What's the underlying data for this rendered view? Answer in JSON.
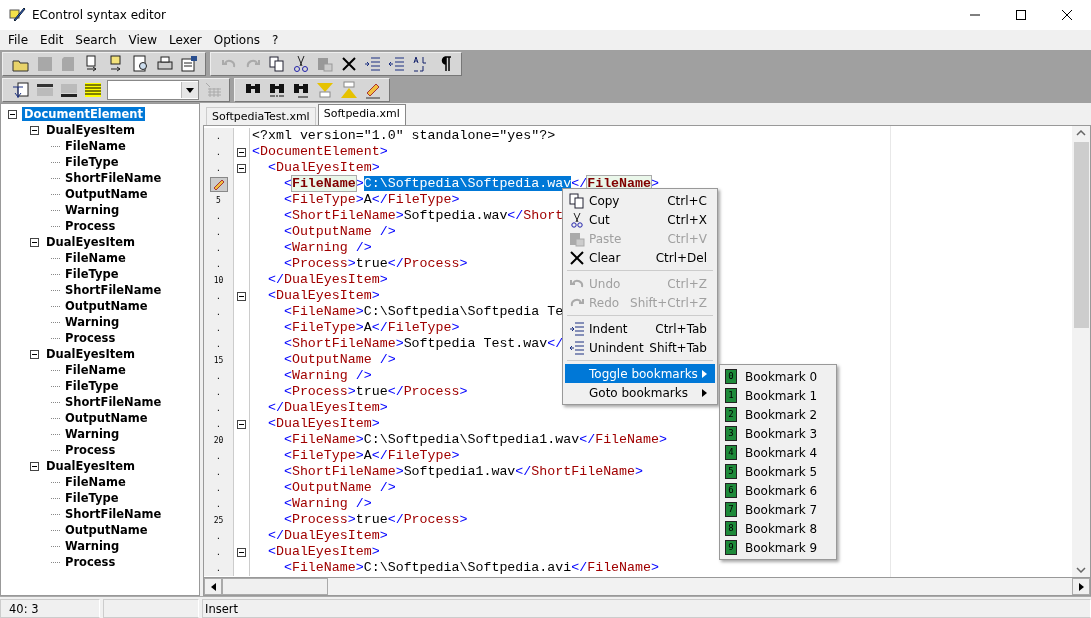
{
  "window": {
    "title": "EControl syntax editor"
  },
  "menubar": [
    "File",
    "Edit",
    "Search",
    "View",
    "Lexer",
    "Options",
    "?"
  ],
  "tree": [
    {
      "label": "DocumentElement",
      "selected": true,
      "expanded": true,
      "children": [
        {
          "label": "DualEyesItem",
          "selected": false,
          "expanded": true,
          "children": [
            {
              "label": "FileName"
            },
            {
              "label": "FileType"
            },
            {
              "label": "ShortFileName"
            },
            {
              "label": "OutputName"
            },
            {
              "label": "Warning"
            },
            {
              "label": "Process"
            }
          ]
        },
        {
          "label": "DualEyesItem",
          "selected": false,
          "expanded": true,
          "children": [
            {
              "label": "FileName"
            },
            {
              "label": "FileType"
            },
            {
              "label": "ShortFileName"
            },
            {
              "label": "OutputName"
            },
            {
              "label": "Warning"
            },
            {
              "label": "Process"
            }
          ]
        },
        {
          "label": "DualEyesItem",
          "selected": false,
          "expanded": true,
          "children": [
            {
              "label": "FileName"
            },
            {
              "label": "FileType"
            },
            {
              "label": "ShortFileName"
            },
            {
              "label": "OutputName"
            },
            {
              "label": "Warning"
            },
            {
              "label": "Process"
            }
          ]
        },
        {
          "label": "DualEyesItem",
          "selected": false,
          "expanded": true,
          "children": [
            {
              "label": "FileName"
            },
            {
              "label": "FileType"
            },
            {
              "label": "ShortFileName"
            },
            {
              "label": "OutputName"
            },
            {
              "label": "Warning"
            },
            {
              "label": "Process"
            }
          ]
        }
      ]
    }
  ],
  "tabs": [
    {
      "label": "SoftpediaTest.xml",
      "selected": false
    },
    {
      "label": "Softpedia.xml",
      "selected": true
    }
  ],
  "lines": [
    {
      "gutter": ".",
      "fold": false,
      "bookmark": false,
      "kind": "declaration",
      "text": "<?xml version=\"1.0\" standalone=\"yes\"?>"
    },
    {
      "gutter": ".",
      "fold": true,
      "bookmark": false,
      "kind": "element",
      "text": "<DocumentElement>"
    },
    {
      "gutter": ".",
      "fold": true,
      "bookmark": false,
      "kind": "element",
      "text": "  <DualEyesItem>"
    },
    {
      "fold": false,
      "bookmark": true,
      "kind": "selected_element",
      "text": "    <FileName>C:\\Softpedia\\Softpedia.wav</FileName>"
    },
    {
      "gutter": "5",
      "fold": false,
      "bookmark": false,
      "kind": "element",
      "text": "    <FileType>A</FileType>"
    },
    {
      "gutter": ".",
      "fold": false,
      "bookmark": false,
      "kind": "element",
      "text": "    <ShortFileName>Softpedia.wav</Short"
    },
    {
      "gutter": ".",
      "fold": false,
      "bookmark": false,
      "kind": "element",
      "text": "    <OutputName />"
    },
    {
      "gutter": ".",
      "fold": false,
      "bookmark": false,
      "kind": "element",
      "text": "    <Warning />"
    },
    {
      "gutter": ".",
      "fold": false,
      "bookmark": false,
      "kind": "element",
      "text": "    <Process>true</Process>"
    },
    {
      "gutter": "10",
      "fold": false,
      "bookmark": false,
      "kind": "element",
      "text": "  </DualEyesItem>"
    },
    {
      "gutter": ".",
      "fold": true,
      "bookmark": false,
      "kind": "element",
      "text": "  <DualEyesItem>"
    },
    {
      "gutter": ".",
      "fold": false,
      "bookmark": false,
      "kind": "element",
      "text": "    <FileName>C:\\Softpedia\\Softpedia Te"
    },
    {
      "gutter": ".",
      "fold": false,
      "bookmark": false,
      "kind": "element",
      "text": "    <FileType>A</FileType>"
    },
    {
      "gutter": ".",
      "fold": false,
      "bookmark": false,
      "kind": "element",
      "text": "    <ShortFileName>Softpedia Test.wav</"
    },
    {
      "gutter": "15",
      "fold": false,
      "bookmark": false,
      "kind": "element",
      "text": "    <OutputName />"
    },
    {
      "gutter": ".",
      "fold": false,
      "bookmark": false,
      "kind": "element",
      "text": "    <Warning />"
    },
    {
      "gutter": ".",
      "fold": false,
      "bookmark": false,
      "kind": "element",
      "text": "    <Process>true</Process>"
    },
    {
      "gutter": ".",
      "fold": false,
      "bookmark": false,
      "kind": "element",
      "text": "  </DualEyesItem>"
    },
    {
      "gutter": ".",
      "fold": true,
      "bookmark": false,
      "kind": "element",
      "text": "  <DualEyesItem>"
    },
    {
      "gutter": "20",
      "fold": false,
      "bookmark": false,
      "kind": "element",
      "text": "    <FileName>C:\\Softpedia\\Softpedia1.wav</FileName>"
    },
    {
      "gutter": ".",
      "fold": false,
      "bookmark": false,
      "kind": "element",
      "text": "    <FileType>A</FileType>"
    },
    {
      "gutter": ".",
      "fold": false,
      "bookmark": false,
      "kind": "element",
      "text": "    <ShortFileName>Softpedia1.wav</ShortFileName>"
    },
    {
      "gutter": ".",
      "fold": false,
      "bookmark": false,
      "kind": "element",
      "text": "    <OutputName />"
    },
    {
      "gutter": ".",
      "fold": false,
      "bookmark": false,
      "kind": "element",
      "text": "    <Warning />"
    },
    {
      "gutter": "25",
      "fold": false,
      "bookmark": false,
      "kind": "element",
      "text": "    <Process>true</Process>"
    },
    {
      "gutter": ".",
      "fold": false,
      "bookmark": false,
      "kind": "element",
      "text": "  </DualEyesItem>"
    },
    {
      "gutter": ".",
      "fold": true,
      "bookmark": false,
      "kind": "element",
      "text": "  <DualEyesItem>"
    },
    {
      "gutter": ".",
      "fold": false,
      "bookmark": false,
      "kind": "element",
      "text": "    <FileName>C:\\Softpedia\\Softpedia.avi</FileName>"
    }
  ],
  "context_menu": [
    {
      "kind": "item",
      "label": "Copy",
      "shortcut": "Ctrl+C",
      "disabled": false,
      "selected": false
    },
    {
      "kind": "item",
      "label": "Cut",
      "shortcut": "Ctrl+X",
      "disabled": false,
      "selected": false
    },
    {
      "kind": "item",
      "label": "Paste",
      "shortcut": "Ctrl+V",
      "disabled": true,
      "selected": false
    },
    {
      "kind": "item",
      "label": "Clear",
      "shortcut": "Ctrl+Del",
      "disabled": false,
      "selected": false
    },
    {
      "kind": "separator"
    },
    {
      "kind": "item",
      "label": "Undo",
      "shortcut": "Ctrl+Z",
      "disabled": true,
      "selected": false
    },
    {
      "kind": "item",
      "label": "Redo",
      "shortcut": "Shift+Ctrl+Z",
      "disabled": true,
      "selected": false
    },
    {
      "kind": "separator"
    },
    {
      "kind": "item",
      "label": "Indent",
      "shortcut": "Ctrl+Tab",
      "disabled": false,
      "selected": false
    },
    {
      "kind": "item",
      "label": "Unindent",
      "shortcut": "Shift+Tab",
      "disabled": false,
      "selected": false
    },
    {
      "kind": "separator"
    },
    {
      "kind": "submenu",
      "label": "Toggle bookmarks",
      "disabled": false,
      "selected": true
    },
    {
      "kind": "submenu",
      "label": "Goto bookmarks",
      "disabled": false,
      "selected": false
    }
  ],
  "submenu": [
    {
      "label": "Bookmark 0",
      "digit": "0"
    },
    {
      "label": "Bookmark 1",
      "digit": "1"
    },
    {
      "label": "Bookmark 2",
      "digit": "2"
    },
    {
      "label": "Bookmark 3",
      "digit": "3"
    },
    {
      "label": "Bookmark 4",
      "digit": "4"
    },
    {
      "label": "Bookmark 5",
      "digit": "5"
    },
    {
      "label": "Bookmark 6",
      "digit": "6"
    },
    {
      "label": "Bookmark 7",
      "digit": "7"
    },
    {
      "label": "Bookmark 8",
      "digit": "8"
    },
    {
      "label": "Bookmark 9",
      "digit": "9"
    }
  ],
  "status_bar": {
    "position": "40: 3",
    "mode": "Insert"
  }
}
